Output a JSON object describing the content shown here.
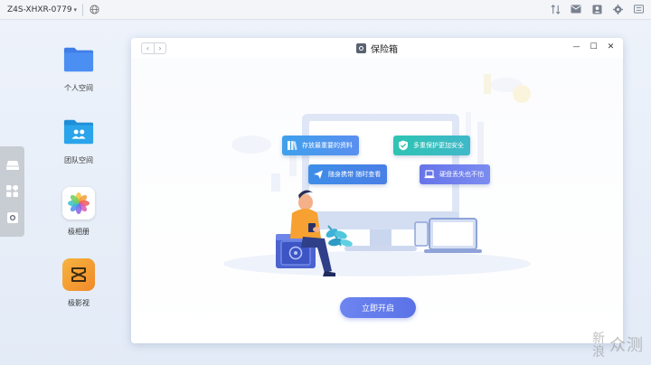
{
  "topbar": {
    "device_name": "Z4S-XHXR-0779",
    "icons": [
      "globe-icon",
      "transfer-icon",
      "message-icon",
      "user-icon",
      "settings-icon",
      "menu-icon"
    ]
  },
  "desktop": {
    "items": [
      {
        "label": "个人空间",
        "icon": "personal-folder-icon"
      },
      {
        "label": "团队空间",
        "icon": "team-folder-icon"
      },
      {
        "label": "极相册",
        "icon": "photos-icon"
      },
      {
        "label": "极影视",
        "icon": "video-icon"
      }
    ]
  },
  "dock": {
    "icons": [
      "storage-icon",
      "apps-icon",
      "safe-icon"
    ]
  },
  "window": {
    "title": "保险箱",
    "nav": {
      "back": "‹",
      "forward": "›"
    },
    "controls": {
      "minimize": "—",
      "maximize": "☐",
      "close": "✕"
    },
    "features": [
      {
        "label": "存放最重要的资料",
        "icon": "files-icon"
      },
      {
        "label": "多重保护更加安全",
        "icon": "shield-icon"
      },
      {
        "label": "随身携带 随时查看",
        "icon": "send-icon"
      },
      {
        "label": "硬盘丢失也不怕",
        "icon": "laptop-icon"
      }
    ],
    "open_button": "立即开启"
  },
  "watermark": {
    "text_a": "新",
    "text_b": "浪",
    "text_c": "众测"
  },
  "colors": {
    "accent": "#5a72e6",
    "tag_blue": "#4f8fe8",
    "tag_teal": "#2fc2b5",
    "tag_indigo": "#6b7fe8"
  }
}
